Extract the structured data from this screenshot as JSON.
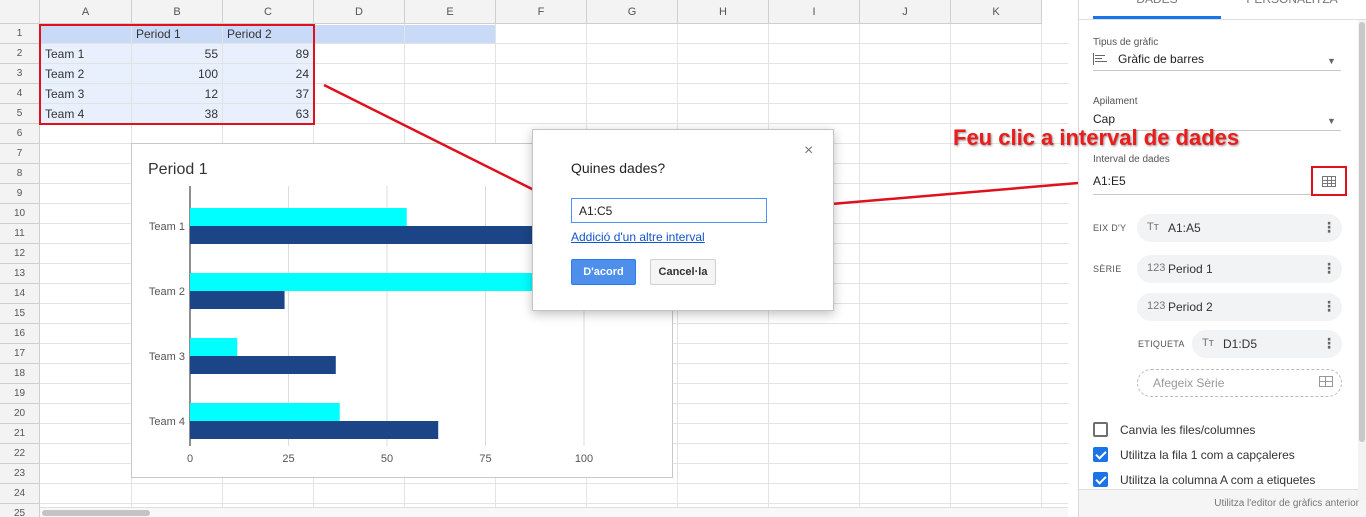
{
  "sheet": {
    "columns": [
      "A",
      "B",
      "C",
      "D",
      "E",
      "F",
      "G",
      "H",
      "I",
      "J",
      "K"
    ],
    "rows": [
      "1",
      "2",
      "3",
      "4",
      "5",
      "6",
      "7",
      "8",
      "9",
      "10",
      "11",
      "12",
      "13",
      "14",
      "15",
      "16",
      "17",
      "18",
      "19",
      "20",
      "21",
      "22",
      "23",
      "24",
      "25"
    ],
    "header": [
      "",
      "Period 1",
      "Period 2"
    ],
    "data": [
      [
        "Team 1",
        "55",
        "89"
      ],
      [
        "Team 2",
        "100",
        "24"
      ],
      [
        "Team 3",
        "12",
        "37"
      ],
      [
        "Team 4",
        "38",
        "63"
      ]
    ]
  },
  "chart_data": {
    "type": "bar",
    "orientation": "horizontal",
    "title": "Period 1",
    "categories": [
      "Team 1",
      "Team 2",
      "Team 3",
      "Team 4"
    ],
    "series": [
      {
        "values": [
          55,
          100,
          12,
          38
        ],
        "color": "#00ffff"
      },
      {
        "values": [
          89,
          24,
          37,
          63
        ],
        "color": "#1c4587"
      }
    ],
    "xlim": [
      0,
      100
    ],
    "xticks": [
      "0",
      "25",
      "50",
      "75",
      "100"
    ],
    "grid": true
  },
  "dialog": {
    "title": "Quines dades?",
    "range_value": "A1:C5",
    "add_range_link": "Addició d'un altre interval",
    "ok_label": "D'acord",
    "cancel_label": "Cancel·la",
    "close_glyph": "×"
  },
  "panel": {
    "tabs": [
      "DADES",
      "PERSONALITZA"
    ],
    "chart_type_label": "Tipus de gràfic",
    "chart_type_value": "Gràfic de barres",
    "stacking_label": "Apilament",
    "stacking_value": "Cap",
    "range_label": "Interval de dades",
    "range_value": "A1:E5",
    "y_axis_label": "EIX D'Y",
    "y_axis_value": "A1:A5",
    "series_label": "SÈRIE",
    "series": [
      "Period 1",
      "Period 2"
    ],
    "label_label": "ETIQUETA",
    "label_value": "D1:D5",
    "add_series": "Afegeix Sèrie",
    "checkboxes": [
      {
        "label": "Canvia les files/columnes",
        "checked": false
      },
      {
        "label": "Utilitza la fila 1 com a capçaleres",
        "checked": true
      },
      {
        "label": "Utilitza la columna A com a etiquetes",
        "checked": true
      }
    ],
    "footer": "Utilitza l'editor de gràfics anterior",
    "type_icon_glyph": "Tт",
    "num_icon_glyph": "123",
    "kebab_glyph": "⋮",
    "dropdown_glyph": "▼"
  },
  "annotation": {
    "text": "Feu clic a interval de dades",
    "color": "#ec1c1c"
  },
  "colors": {
    "accent": "#1a73e8",
    "selection": "#e8f0fe",
    "highlight": "#e0101c"
  }
}
